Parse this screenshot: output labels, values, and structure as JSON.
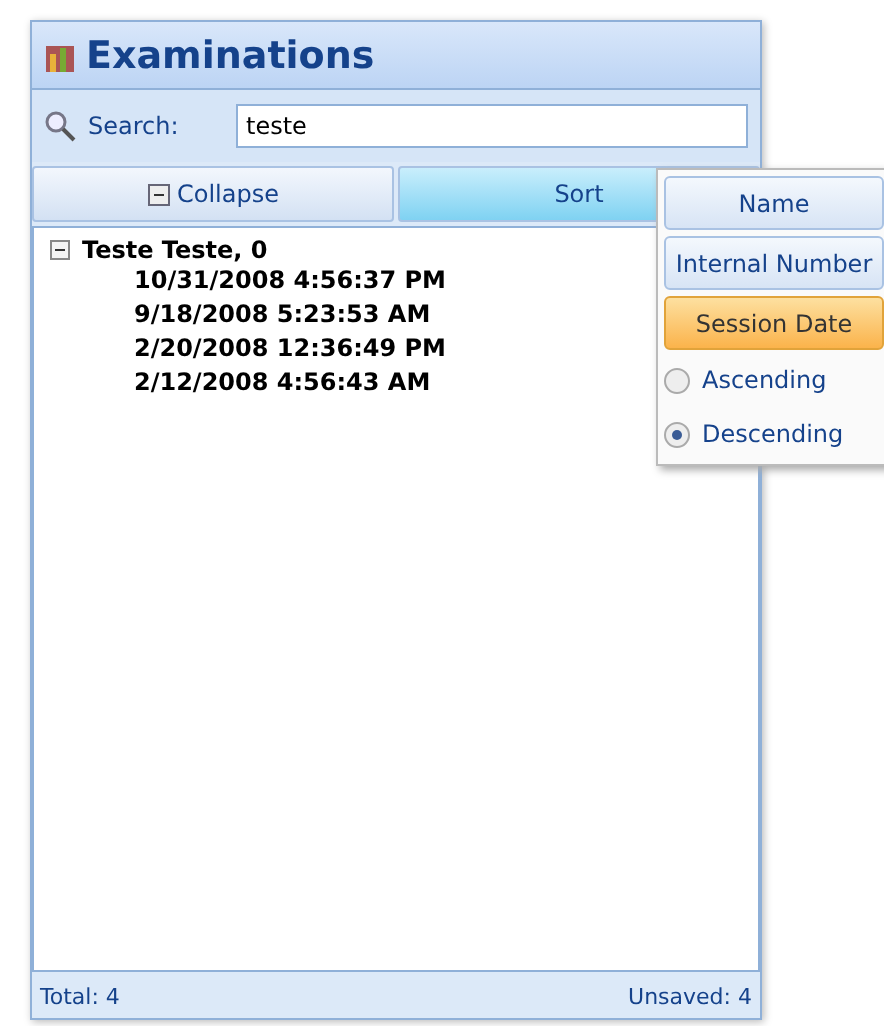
{
  "window": {
    "title": "Examinations"
  },
  "search": {
    "label": "Search:",
    "value": "teste"
  },
  "buttons": [
    {
      "label": "Collapse",
      "kind": "collapse",
      "selected": false
    },
    {
      "label": "Sort",
      "kind": "sort",
      "selected": true
    }
  ],
  "tree": [
    {
      "label": "Teste Teste, 0",
      "expanded": true,
      "children": [
        {
          "label": "10/31/2008 4:56:37 PM"
        },
        {
          "label": "9/18/2008 5:23:53 AM"
        },
        {
          "label": "2/20/2008 12:36:49 PM"
        },
        {
          "label": "2/12/2008 4:56:43 AM"
        }
      ]
    }
  ],
  "sort_menu": {
    "fields": [
      {
        "label": "Name",
        "selected": false
      },
      {
        "label": "Internal Number",
        "selected": false
      },
      {
        "label": "Session Date",
        "selected": true
      }
    ],
    "orders": [
      {
        "label": "Ascending",
        "selected": false
      },
      {
        "label": "Descending",
        "selected": true
      }
    ]
  },
  "status_bar": {
    "total": "Total: 4",
    "unsaved": "Unsaved: 4"
  }
}
